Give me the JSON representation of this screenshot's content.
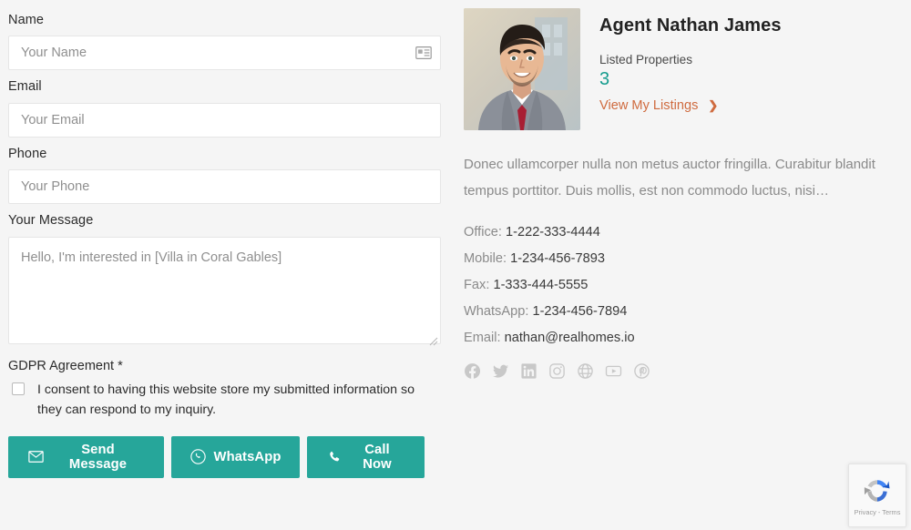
{
  "form": {
    "fields": [
      {
        "label": "Name",
        "placeholder": "Your Name",
        "value": "",
        "icon": "contact-card-icon"
      },
      {
        "label": "Email",
        "placeholder": "Your Email",
        "value": "",
        "icon": ""
      },
      {
        "label": "Phone",
        "placeholder": "Your Phone",
        "value": "",
        "icon": ""
      }
    ],
    "message": {
      "label": "Your Message",
      "placeholder": "Hello, I'm interested in [Villa in Coral Gables]",
      "value": ""
    },
    "gdpr": {
      "title": "GDPR Agreement *",
      "consent_text": "I consent to having this website store my submitted information so they can respond to my inquiry.",
      "checked": false
    },
    "buttons": [
      {
        "label": "Send Message",
        "icon": "envelope-icon"
      },
      {
        "label": "WhatsApp",
        "icon": "whatsapp-icon"
      },
      {
        "label": "Call Now",
        "icon": "phone-icon"
      }
    ]
  },
  "agent": {
    "name": "Agent Nathan James",
    "listed_label": "Listed Properties",
    "listed_count": "3",
    "view_listings_label": "View My Listings",
    "view_listings_chevron": "❯",
    "description": "Donec ullamcorper nulla non metus auctor fringilla. Curabitur blandit tempus porttitor. Duis mollis, est non commodo luctus, nisi…",
    "contacts": [
      {
        "label": "Office:",
        "value": "1-222-333-4444"
      },
      {
        "label": "Mobile:",
        "value": "1-234-456-7893"
      },
      {
        "label": "Fax:",
        "value": "1-333-444-5555"
      },
      {
        "label": "WhatsApp:",
        "value": "1-234-456-7894"
      },
      {
        "label": "Email:",
        "value": "nathan@realhomes.io"
      }
    ],
    "socials": [
      {
        "name": "facebook-icon"
      },
      {
        "name": "twitter-icon"
      },
      {
        "name": "linkedin-icon"
      },
      {
        "name": "instagram-icon"
      },
      {
        "name": "website-globe-icon"
      },
      {
        "name": "youtube-icon"
      },
      {
        "name": "pinterest-icon"
      }
    ]
  },
  "recaptcha": {
    "privacy_terms": "Privacy - Terms"
  },
  "colors": {
    "accent_teal": "#26a69a",
    "link_orange": "#cf6b3f",
    "count_teal": "#159c8e",
    "page_bg": "#f5f5f5"
  }
}
